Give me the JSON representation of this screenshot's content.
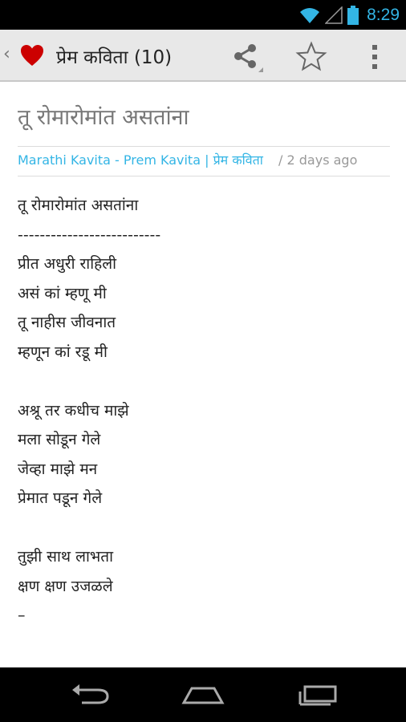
{
  "status": {
    "time": "8:29"
  },
  "actionbar": {
    "title": "प्रेम कविता (10)"
  },
  "post": {
    "title": "तू रोमारोमांत असतांना",
    "category": "Marathi Kavita - Prem Kavita | प्रेम कविता",
    "time": "/ 2 days ago",
    "lines": [
      "तू रोमारोमांत असतांना",
      "--------------------------",
      "प्रीत अधुरी राहिली",
      "असं कां म्हणू मी",
      "तू नाहीस जीवनात",
      "म्हणून कां रडू मी",
      "",
      "अश्रू तर कधीच माझे",
      "मला सोडून गेले",
      "जेव्हा माझे मन",
      "प्रेमात पडून गेले",
      "",
      "तुझी साथ लाभता",
      "क्षण क्षण उजळले",
      "–"
    ]
  }
}
